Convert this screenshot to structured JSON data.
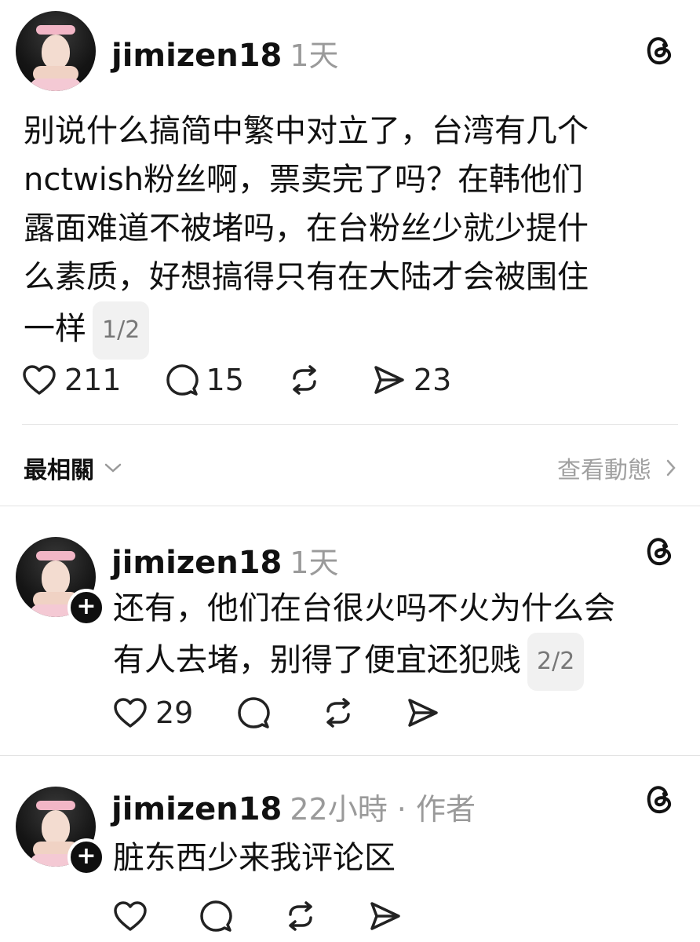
{
  "threads_logo": "threads-icon",
  "posts": [
    {
      "username": "jimizen18",
      "time": "1天",
      "text_lines": [
        "别说什么搞简中繁中对立了，台湾有几个",
        "nctwish粉丝啊，票卖完了吗？在韩他们",
        "露面难道不被堵吗，在台粉丝少就少提什",
        "么素质，好想搞得只有在大陆才会被围住",
        "一样"
      ],
      "pager": "1/2",
      "likes": "211",
      "comments": "15",
      "shares": "23"
    },
    {
      "username": "jimizen18",
      "time": "1天",
      "text_lines": [
        "还有，他们在台很火吗不火为什么会",
        "有人去堵，别得了便宜还犯贱"
      ],
      "pager": "2/2",
      "likes": "29"
    },
    {
      "username": "jimizen18",
      "time": "22小時 · 作者",
      "text_lines": [
        "脏东西少来我评论区"
      ]
    }
  ],
  "replies_bar": {
    "sort_label": "最相關",
    "activity_label": "查看動態"
  }
}
